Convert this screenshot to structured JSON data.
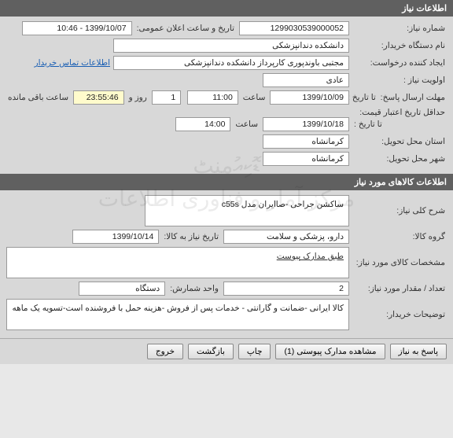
{
  "section1": {
    "header": "اطلاعات نیاز",
    "need_number_label": "شماره نیاز:",
    "need_number": "1299030539000052",
    "announce_label": "تاریخ و ساعت اعلان عمومی:",
    "announce_value": "1399/10/07 - 10:46",
    "buyer_label": "نام دستگاه خریدار:",
    "buyer_value": "دانشکده دندانپزشکی",
    "creator_label": "ایجاد کننده درخواست:",
    "creator_value": "مجتبی  باوندپوری کارپرداز دانشکده دندانپزشکی",
    "contact_link": "اطلاعات تماس خریدار",
    "priority_label": "اولویت نیاز :",
    "priority_value": "عادی",
    "response_deadline_label": "مهلت ارسال پاسخ:",
    "to_date_label": "تا تاریخ :",
    "response_date": "1399/10/09",
    "time_label": "ساعت",
    "response_time": "11:00",
    "day_count": "1",
    "day_and_label": "روز و",
    "remaining_time": "23:55:46",
    "remaining_label": "ساعت باقی مانده",
    "min_validity_label": "حداقل تاریخ اعتبار قیمت:",
    "validity_date": "1399/10/18",
    "validity_time": "14:00",
    "province_label": "استان محل تحویل:",
    "province_value": "کرمانشاه",
    "city_label": "شهر محل تحویل:",
    "city_value": "کرمانشاه"
  },
  "section2": {
    "header": "اطلاعات کالاهای مورد نیاز",
    "desc_label": "شرح کلی نیاز:",
    "desc_value": "ساکشن جراحی -صاایران مدل c55s",
    "group_label": "گروه کالا:",
    "group_value": "دارو، پزشکی و سلامت",
    "need_by_label": "تاریخ نیاز به کالا:",
    "need_by_value": "1399/10/14",
    "spec_label": "مشخصات کالای مورد نیاز:",
    "attach_link": "طبق مدارک پیوست",
    "qty_label": "تعداد / مقدار مورد نیاز:",
    "qty_value": "2",
    "unit_label": "واحد شمارش:",
    "unit_value": "دستگاه",
    "notes_label": "توضیحات خریدار:",
    "notes_value": "کالا ایرانی -ضمانت و گارانتی - خدمات پس از فروش -هزینه حمل با فروشنده است-تسویه یک ماهه"
  },
  "footer": {
    "reply": "پاسخ به نیاز",
    "view_attach": "مشاهده مدارک پیوستی (1)",
    "print": "چاپ",
    "back": "بازگشت",
    "exit": "خروج"
  },
  "watermark_line1": "ޑޮކިއުمنٹ",
  "watermark_line2": "مرکز آمار و فناوری اطلاعات"
}
